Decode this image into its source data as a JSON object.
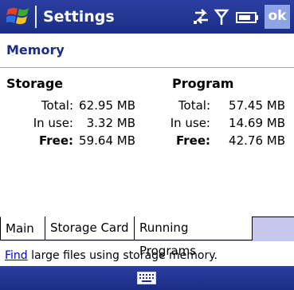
{
  "titlebar": {
    "title": "Settings",
    "ok_label": "ok"
  },
  "header": {
    "title": "Memory"
  },
  "storage": {
    "heading": "Storage",
    "total_label": "Total:",
    "total_value": "62.95 MB",
    "inuse_label": "In use:",
    "inuse_value": "3.32 MB",
    "free_label": "Free:",
    "free_value": "59.64 MB"
  },
  "program": {
    "heading": "Program",
    "total_label": "Total:",
    "total_value": "57.45 MB",
    "inuse_label": "In use:",
    "inuse_value": "14.69 MB",
    "free_label": "Free:",
    "free_value": "42.76 MB"
  },
  "tabs": [
    {
      "label": "Main"
    },
    {
      "label": "Storage Card"
    },
    {
      "label": "Running Programs"
    }
  ],
  "hint": {
    "link_text": "Find",
    "rest_text": " large files using storage memory."
  },
  "icons": {
    "start": "windows-flag-icon",
    "connectivity": "sync-arrows-icon",
    "signal": "antenna-icon",
    "battery": "battery-icon",
    "keyboard": "keyboard-icon"
  },
  "colors": {
    "titlebar": "#1b2d86",
    "header_text": "#1b2d86",
    "tab_strip": "#c6c7ef",
    "ok_button": "#8ea4e6",
    "link": "#0000cc"
  }
}
